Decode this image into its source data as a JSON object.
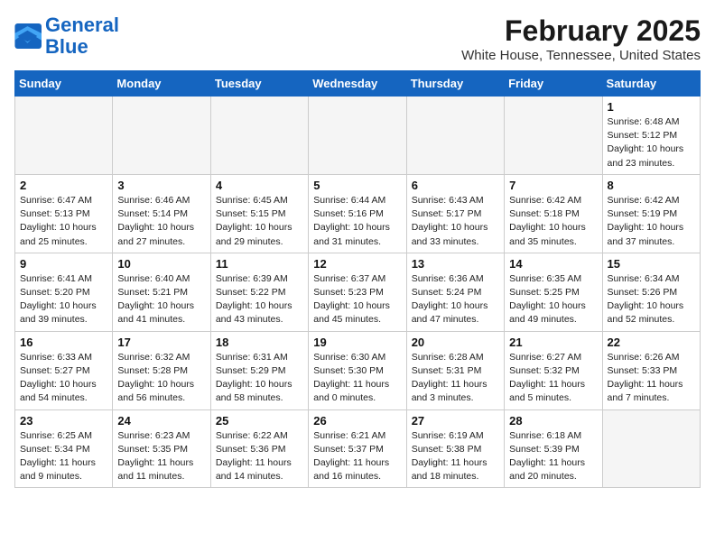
{
  "logo": {
    "line1": "General",
    "line2": "Blue"
  },
  "title": "February 2025",
  "subtitle": "White House, Tennessee, United States",
  "days_of_week": [
    "Sunday",
    "Monday",
    "Tuesday",
    "Wednesday",
    "Thursday",
    "Friday",
    "Saturday"
  ],
  "weeks": [
    [
      {
        "day": "",
        "detail": ""
      },
      {
        "day": "",
        "detail": ""
      },
      {
        "day": "",
        "detail": ""
      },
      {
        "day": "",
        "detail": ""
      },
      {
        "day": "",
        "detail": ""
      },
      {
        "day": "",
        "detail": ""
      },
      {
        "day": "1",
        "detail": "Sunrise: 6:48 AM\nSunset: 5:12 PM\nDaylight: 10 hours and 23 minutes."
      }
    ],
    [
      {
        "day": "2",
        "detail": "Sunrise: 6:47 AM\nSunset: 5:13 PM\nDaylight: 10 hours and 25 minutes."
      },
      {
        "day": "3",
        "detail": "Sunrise: 6:46 AM\nSunset: 5:14 PM\nDaylight: 10 hours and 27 minutes."
      },
      {
        "day": "4",
        "detail": "Sunrise: 6:45 AM\nSunset: 5:15 PM\nDaylight: 10 hours and 29 minutes."
      },
      {
        "day": "5",
        "detail": "Sunrise: 6:44 AM\nSunset: 5:16 PM\nDaylight: 10 hours and 31 minutes."
      },
      {
        "day": "6",
        "detail": "Sunrise: 6:43 AM\nSunset: 5:17 PM\nDaylight: 10 hours and 33 minutes."
      },
      {
        "day": "7",
        "detail": "Sunrise: 6:42 AM\nSunset: 5:18 PM\nDaylight: 10 hours and 35 minutes."
      },
      {
        "day": "8",
        "detail": "Sunrise: 6:42 AM\nSunset: 5:19 PM\nDaylight: 10 hours and 37 minutes."
      }
    ],
    [
      {
        "day": "9",
        "detail": "Sunrise: 6:41 AM\nSunset: 5:20 PM\nDaylight: 10 hours and 39 minutes."
      },
      {
        "day": "10",
        "detail": "Sunrise: 6:40 AM\nSunset: 5:21 PM\nDaylight: 10 hours and 41 minutes."
      },
      {
        "day": "11",
        "detail": "Sunrise: 6:39 AM\nSunset: 5:22 PM\nDaylight: 10 hours and 43 minutes."
      },
      {
        "day": "12",
        "detail": "Sunrise: 6:37 AM\nSunset: 5:23 PM\nDaylight: 10 hours and 45 minutes."
      },
      {
        "day": "13",
        "detail": "Sunrise: 6:36 AM\nSunset: 5:24 PM\nDaylight: 10 hours and 47 minutes."
      },
      {
        "day": "14",
        "detail": "Sunrise: 6:35 AM\nSunset: 5:25 PM\nDaylight: 10 hours and 49 minutes."
      },
      {
        "day": "15",
        "detail": "Sunrise: 6:34 AM\nSunset: 5:26 PM\nDaylight: 10 hours and 52 minutes."
      }
    ],
    [
      {
        "day": "16",
        "detail": "Sunrise: 6:33 AM\nSunset: 5:27 PM\nDaylight: 10 hours and 54 minutes."
      },
      {
        "day": "17",
        "detail": "Sunrise: 6:32 AM\nSunset: 5:28 PM\nDaylight: 10 hours and 56 minutes."
      },
      {
        "day": "18",
        "detail": "Sunrise: 6:31 AM\nSunset: 5:29 PM\nDaylight: 10 hours and 58 minutes."
      },
      {
        "day": "19",
        "detail": "Sunrise: 6:30 AM\nSunset: 5:30 PM\nDaylight: 11 hours and 0 minutes."
      },
      {
        "day": "20",
        "detail": "Sunrise: 6:28 AM\nSunset: 5:31 PM\nDaylight: 11 hours and 3 minutes."
      },
      {
        "day": "21",
        "detail": "Sunrise: 6:27 AM\nSunset: 5:32 PM\nDaylight: 11 hours and 5 minutes."
      },
      {
        "day": "22",
        "detail": "Sunrise: 6:26 AM\nSunset: 5:33 PM\nDaylight: 11 hours and 7 minutes."
      }
    ],
    [
      {
        "day": "23",
        "detail": "Sunrise: 6:25 AM\nSunset: 5:34 PM\nDaylight: 11 hours and 9 minutes."
      },
      {
        "day": "24",
        "detail": "Sunrise: 6:23 AM\nSunset: 5:35 PM\nDaylight: 11 hours and 11 minutes."
      },
      {
        "day": "25",
        "detail": "Sunrise: 6:22 AM\nSunset: 5:36 PM\nDaylight: 11 hours and 14 minutes."
      },
      {
        "day": "26",
        "detail": "Sunrise: 6:21 AM\nSunset: 5:37 PM\nDaylight: 11 hours and 16 minutes."
      },
      {
        "day": "27",
        "detail": "Sunrise: 6:19 AM\nSunset: 5:38 PM\nDaylight: 11 hours and 18 minutes."
      },
      {
        "day": "28",
        "detail": "Sunrise: 6:18 AM\nSunset: 5:39 PM\nDaylight: 11 hours and 20 minutes."
      },
      {
        "day": "",
        "detail": ""
      }
    ]
  ]
}
